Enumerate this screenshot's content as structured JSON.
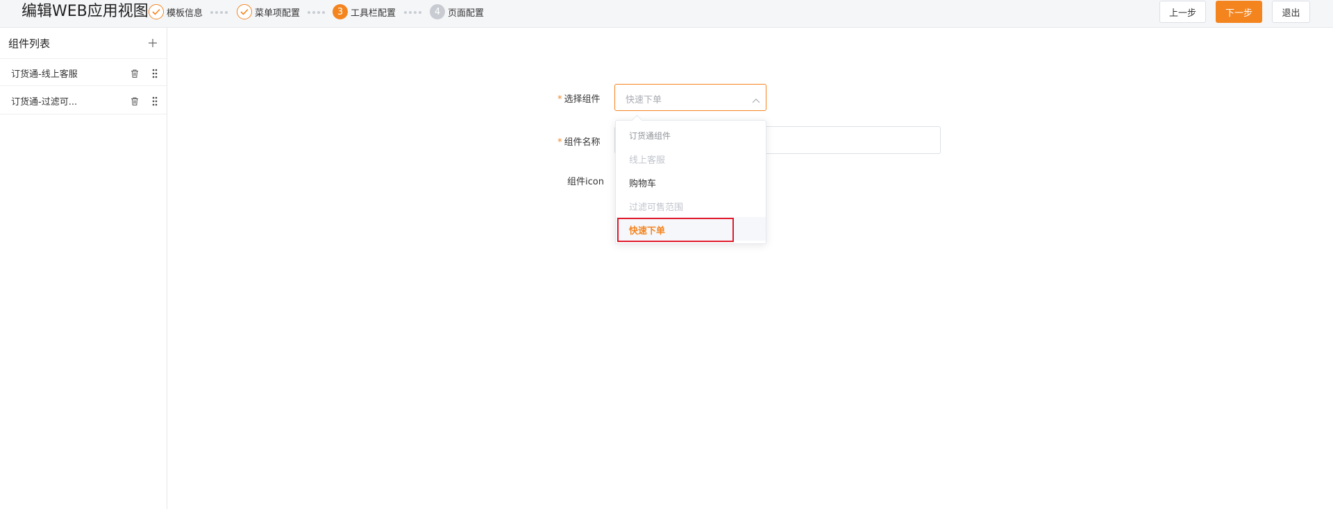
{
  "header": {
    "title": "编辑WEB应用视图",
    "steps": [
      {
        "number": "1",
        "label": "模板信息",
        "status": "done"
      },
      {
        "number": "2",
        "label": "菜单项配置",
        "status": "done"
      },
      {
        "number": "3",
        "label": "工具栏配置",
        "status": "active"
      },
      {
        "number": "4",
        "label": "页面配置",
        "status": "pending"
      }
    ],
    "buttons": {
      "prev": "上一步",
      "next": "下一步",
      "exit": "退出"
    }
  },
  "sidebar": {
    "title": "组件列表",
    "items": [
      {
        "label": "订货通-线上客服"
      },
      {
        "label": "订货通-过滤可..."
      }
    ]
  },
  "form": {
    "select_component": {
      "label": "选择组件",
      "value": "快速下单",
      "required": true
    },
    "component_name": {
      "label": "组件名称",
      "required": true,
      "value": ""
    },
    "component_icon": {
      "label": "组件icon"
    }
  },
  "dropdown": {
    "options": [
      {
        "label": "订货通组件",
        "type": "group"
      },
      {
        "label": "线上客服",
        "type": "disabled"
      },
      {
        "label": "购物车",
        "type": "normal"
      },
      {
        "label": "过滤可售范围",
        "type": "disabled"
      },
      {
        "label": "快速下单",
        "type": "selected"
      }
    ]
  },
  "colors": {
    "accent": "#f4841e",
    "highlight_border": "#e0192a",
    "pending_step": "#c8cbd1"
  }
}
